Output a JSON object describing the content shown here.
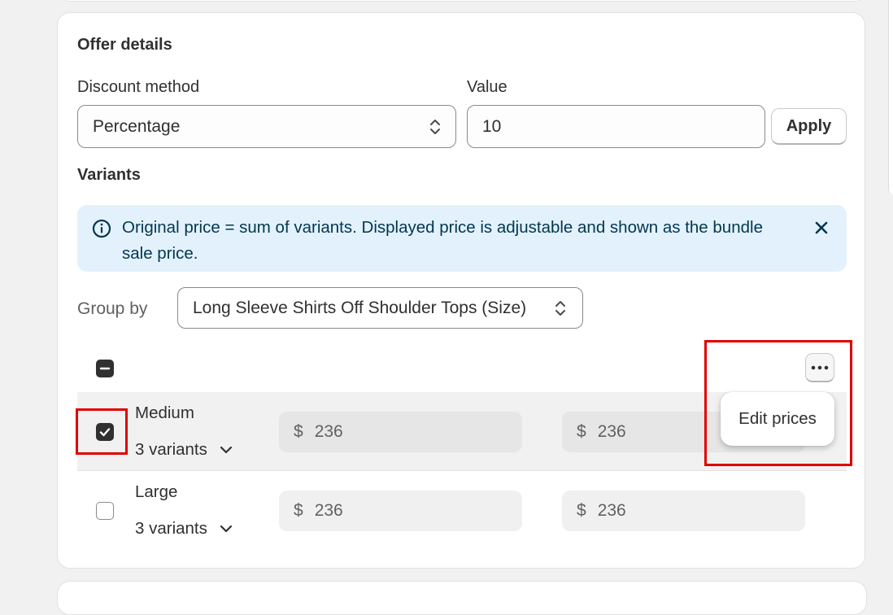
{
  "offer": {
    "title": "Offer details",
    "discount_method_label": "Discount method",
    "discount_method_value": "Percentage",
    "value_label": "Value",
    "value": "10",
    "apply_label": "Apply"
  },
  "variants": {
    "title": "Variants",
    "banner_text": "Original price = sum of variants. Displayed price is adjustable and shown as the bundle sale price.",
    "group_by_label": "Group by",
    "group_by_value": "Long Sleeve Shirts Off Shoulder Tops (Size)",
    "rows": [
      {
        "name": "Medium",
        "count": "3 variants",
        "currency": "$",
        "price1": "236",
        "price2": "236",
        "checked": true
      },
      {
        "name": "Large",
        "count": "3 variants",
        "currency": "$",
        "price1": "236",
        "price2": "236",
        "checked": false
      }
    ],
    "menu": {
      "edit_prices": "Edit prices"
    }
  },
  "colors": {
    "banner_bg": "#e3f1fc",
    "banner_text": "#00374f",
    "highlight": "#e00000",
    "checkbox": "#303030"
  },
  "icons": [
    "info-icon",
    "close-icon",
    "select-arrows-icon",
    "chevron-down-icon",
    "more-horizontal-icon",
    "checkmark-icon",
    "minus-icon"
  ]
}
